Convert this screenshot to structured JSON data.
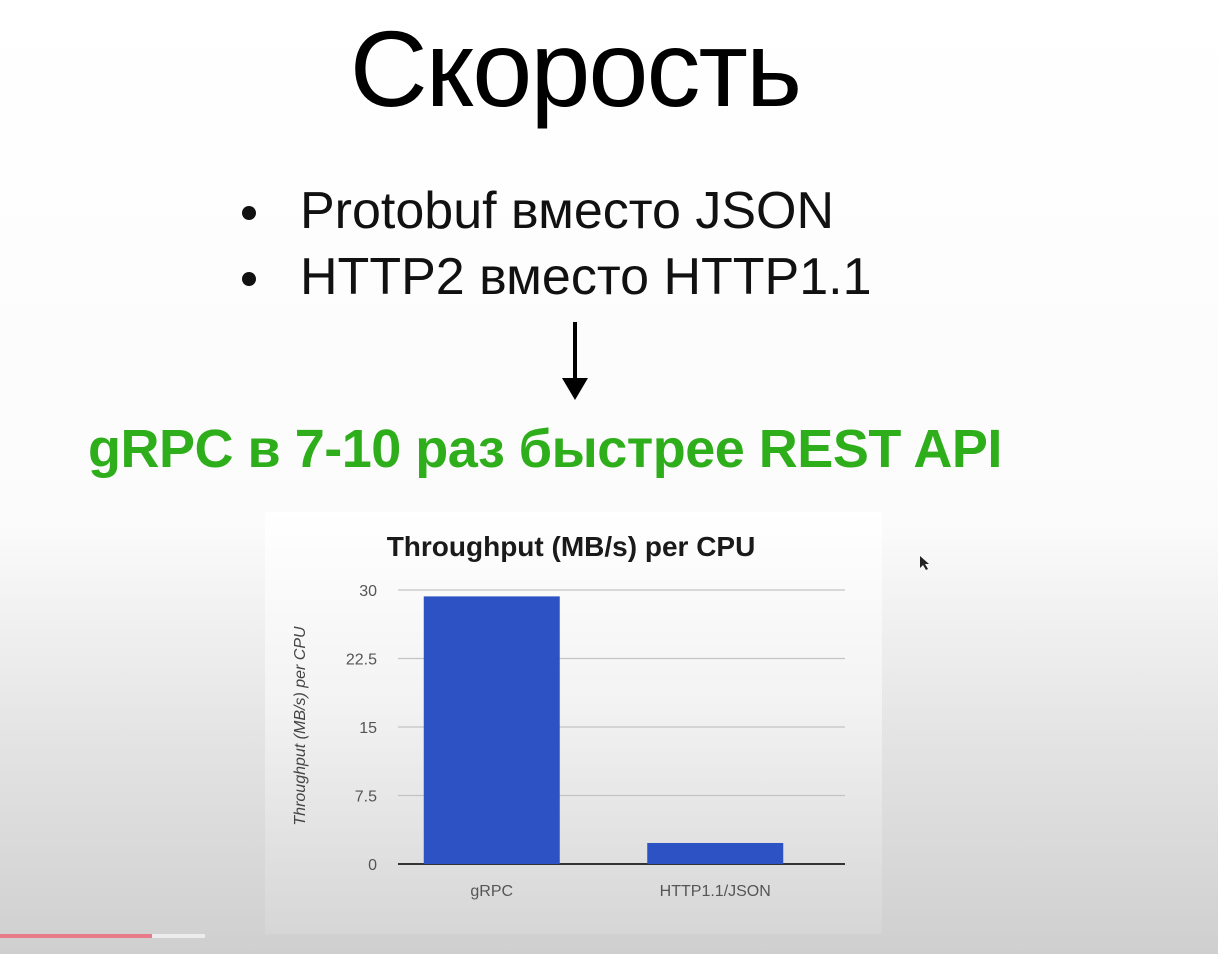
{
  "slide": {
    "title": "Скорость",
    "bullets": [
      "Protobuf вместо JSON",
      "HTTP2 вместо HTTP1.1"
    ],
    "headline": "gRPC в 7-10 раз быстрее REST API",
    "headline_color": "#2fae1c",
    "arrow_icon": "arrow-down"
  },
  "video": {
    "progress": 0.74
  },
  "chart_data": {
    "type": "bar",
    "title": "Throughput (MB/s) per CPU",
    "ylabel": "Throughput (MB/s) per CPU",
    "xlabel": "",
    "categories": [
      "gRPC",
      "HTTP1.1/JSON"
    ],
    "values": [
      29.3,
      2.3
    ],
    "ylim": [
      0,
      30
    ],
    "yticks": [
      "30",
      "22.5",
      "15",
      "7.5",
      "0"
    ],
    "grid": true,
    "bar_color": "#2d52c4"
  }
}
